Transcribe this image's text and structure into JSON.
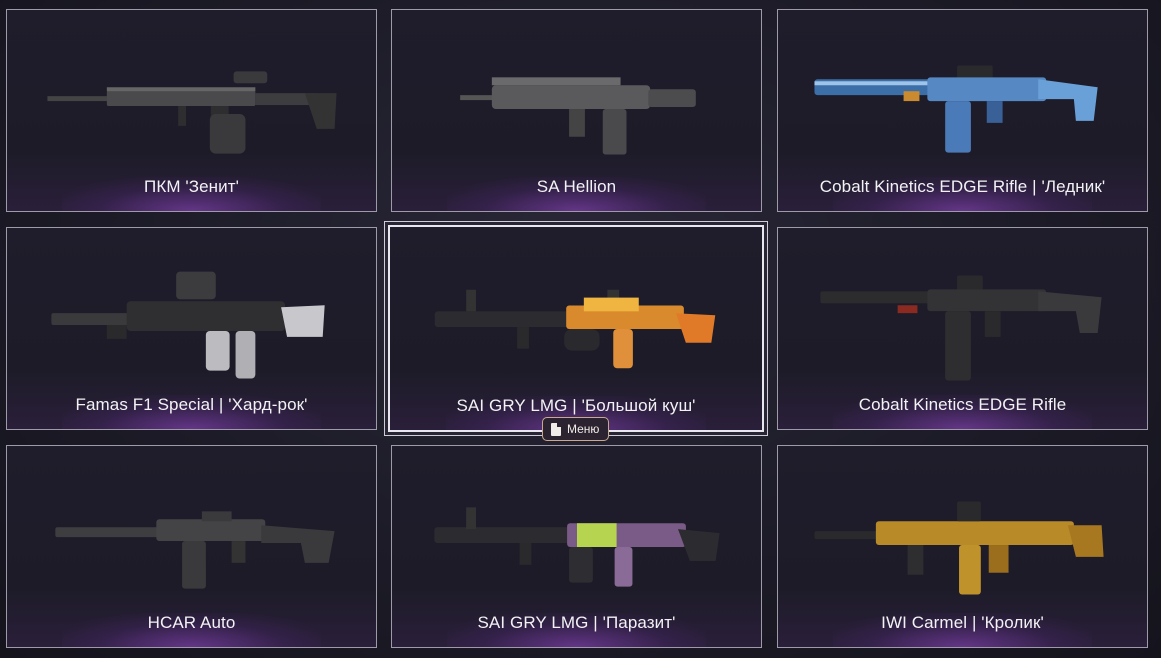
{
  "items": [
    {
      "name": "ПКМ 'Зенит'",
      "skin": "dark"
    },
    {
      "name": "SA Hellion",
      "skin": "dark"
    },
    {
      "name": "Cobalt Kinetics EDGE Rifle | 'Ледник'",
      "skin": "ice"
    },
    {
      "name": "Famas F1 Special | 'Хард-рок'",
      "skin": "dark"
    },
    {
      "name": "SAI GRY LMG | 'Большой куш'",
      "skin": "fire",
      "selected": true
    },
    {
      "name": "Cobalt Kinetics EDGE Rifle",
      "skin": "dark"
    },
    {
      "name": "HCAR Auto",
      "skin": "dark"
    },
    {
      "name": "SAI GRY LMG | 'Паразит'",
      "skin": "parasite"
    },
    {
      "name": "IWI Carmel | 'Кролик'",
      "skin": "gold"
    }
  ],
  "context_menu": {
    "label": "Меню",
    "icon": "document-icon"
  },
  "colors": {
    "accent_glow": "#aa50e6",
    "card_border": "#9e9aa8"
  }
}
